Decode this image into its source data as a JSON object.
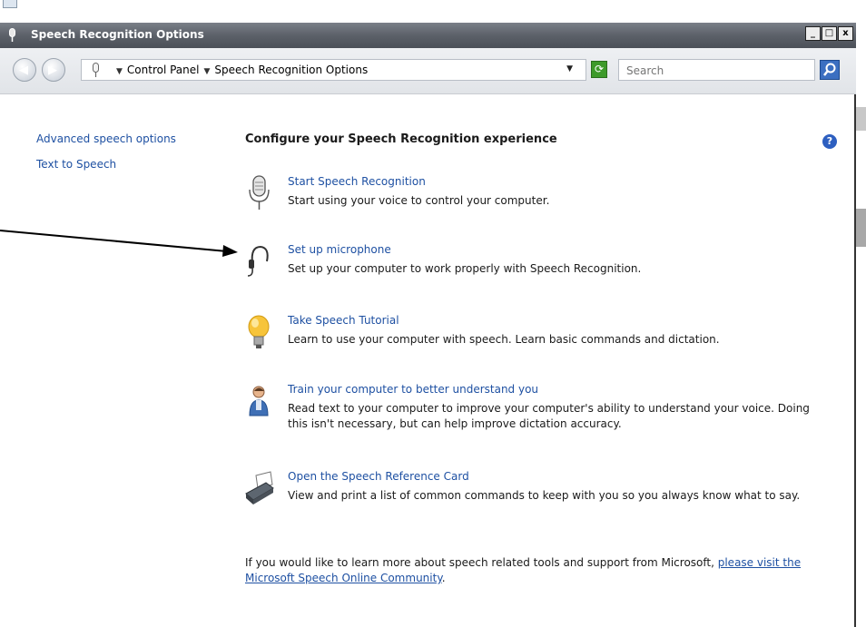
{
  "window": {
    "title": "Speech Recognition Options",
    "buttons": {
      "minimize": "_",
      "maximize": "□",
      "close": "x"
    }
  },
  "navbar": {
    "breadcrumbs": [
      "Control Panel",
      "Speech Recognition Options"
    ],
    "search_placeholder": "Search"
  },
  "sidebar": {
    "links": [
      "Advanced speech options",
      "Text to Speech"
    ]
  },
  "main": {
    "heading": "Configure your Speech Recognition experience",
    "help": "?",
    "tasks": [
      {
        "icon": "microphone-icon",
        "title": "Start Speech Recognition",
        "desc": "Start using your voice to control your computer."
      },
      {
        "icon": "headset-icon",
        "title": "Set up microphone",
        "desc": "Set up your computer to work properly with Speech Recognition."
      },
      {
        "icon": "lightbulb-icon",
        "title": "Take Speech Tutorial",
        "desc": "Learn to use your computer with speech.  Learn basic commands and dictation."
      },
      {
        "icon": "user-icon",
        "title": "Train your computer to better understand you",
        "desc": "Read text to your computer to improve your computer's ability to understand your voice.  Doing this isn't necessary, but can help improve dictation accuracy."
      },
      {
        "icon": "printer-icon",
        "title": "Open the Speech Reference Card",
        "desc": "View and print a list of common commands to keep with you so you always know what to say."
      }
    ],
    "footer": {
      "text": "If you would like to learn more about speech related tools and support from Microsoft, ",
      "link": "please visit the Microsoft Speech Online Community",
      "end": "."
    }
  },
  "colors": {
    "link": "#1e50a2",
    "titlebar": "#5c6169"
  }
}
